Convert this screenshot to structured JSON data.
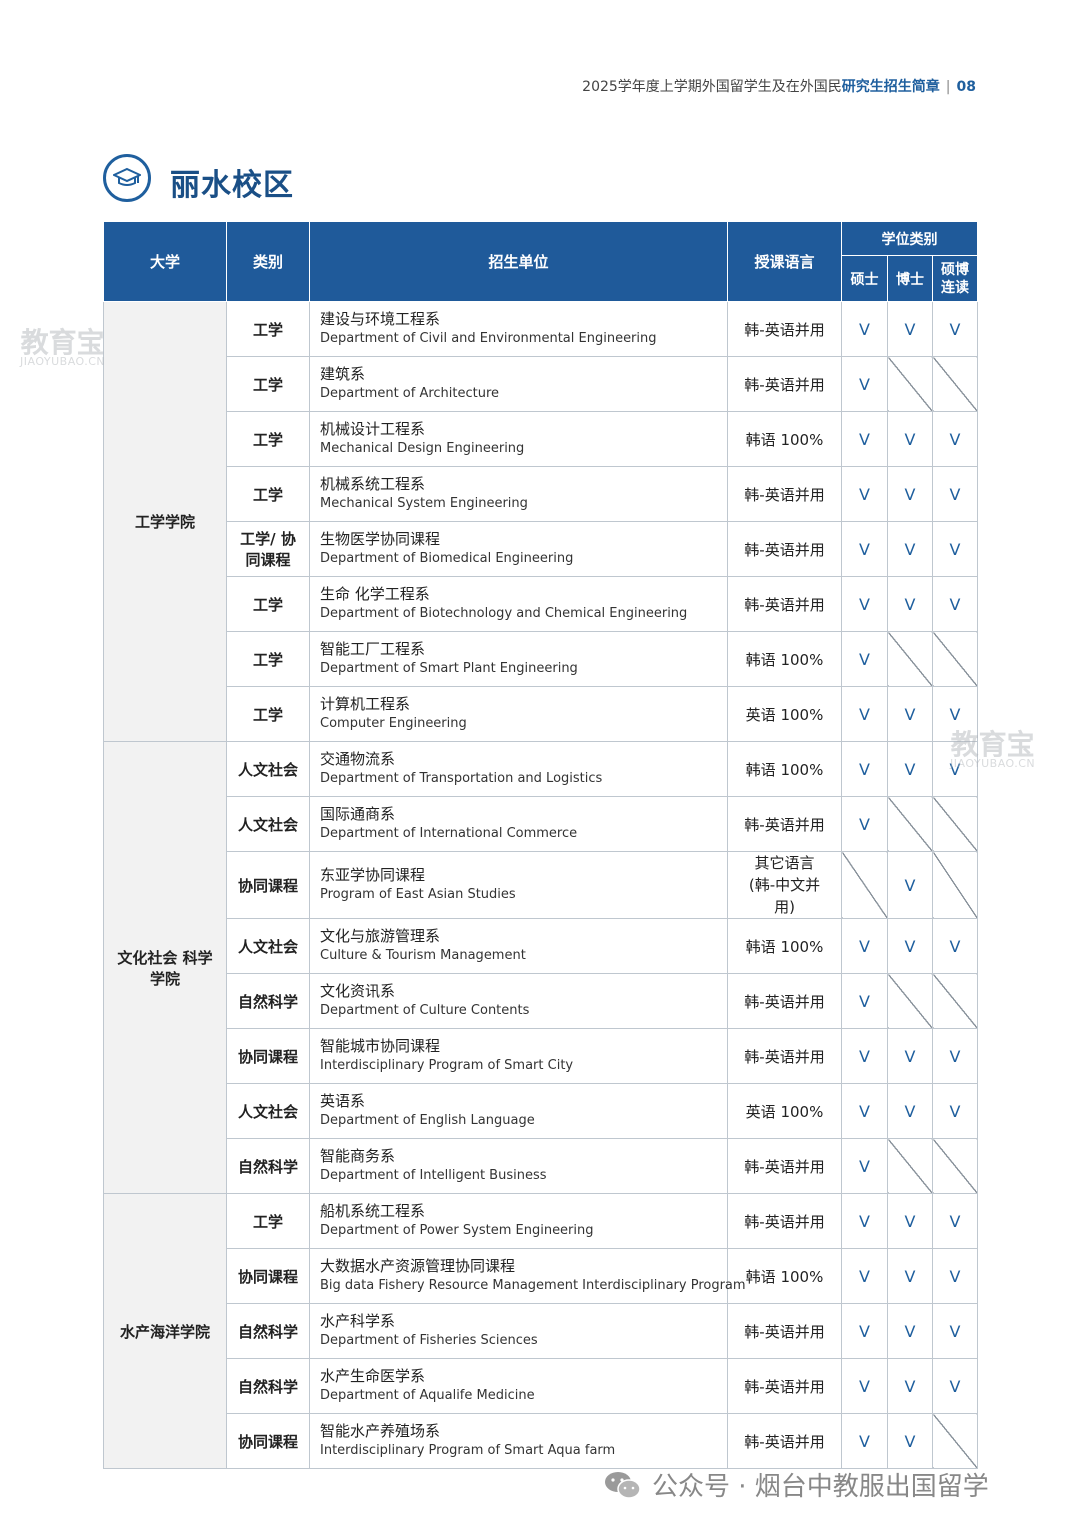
{
  "header": {
    "prefix": "2025学年度上学期外国留学生及在外国民",
    "bold": "研究生招生简章",
    "separator": "|",
    "page": "08"
  },
  "section_title": "丽水校区",
  "table": {
    "headers": {
      "university": "大学",
      "category": "类别",
      "unit": "招生单位",
      "language": "授课语言",
      "degree_group": "学位类别",
      "master": "硕士",
      "doctor": "博士",
      "combined": "硕博连读"
    },
    "groups": [
      {
        "university": "工学学院",
        "rows": [
          {
            "cat": "工学",
            "ko": "建设与环境工程系",
            "en": "Department of Civil and Environmental Engineering",
            "lang": "韩-英语并用",
            "m": "V",
            "d": "V",
            "c": "V"
          },
          {
            "cat": "工学",
            "ko": "建筑系",
            "en": "Department of Architecture",
            "lang": "韩-英语并用",
            "m": "V",
            "d": "",
            "c": ""
          },
          {
            "cat": "工学",
            "ko": "机械设计工程系",
            "en": "Mechanical Design Engineering",
            "lang": "韩语 100%",
            "m": "V",
            "d": "V",
            "c": "V"
          },
          {
            "cat": "工学",
            "ko": "机械系统工程系",
            "en": "Mechanical System Engineering",
            "lang": "韩-英语并用",
            "m": "V",
            "d": "V",
            "c": "V"
          },
          {
            "cat": "工学/ 协同课程",
            "ko": "生物医学协同课程",
            "en": "Department of Biomedical Engineering",
            "lang": "韩-英语并用",
            "m": "V",
            "d": "V",
            "c": "V"
          },
          {
            "cat": "工学",
            "ko": "生命 化学工程系",
            "en": "Department of Biotechnology and Chemical Engineering",
            "lang": "韩-英语并用",
            "m": "V",
            "d": "V",
            "c": "V"
          },
          {
            "cat": "工学",
            "ko": "智能工厂工程系",
            "en": "Department of Smart Plant Engineering",
            "lang": "韩语 100%",
            "m": "V",
            "d": "",
            "c": ""
          },
          {
            "cat": "工学",
            "ko": "计算机工程系",
            "en": "Computer Engineering",
            "lang": "英语 100%",
            "m": "V",
            "d": "V",
            "c": "V"
          }
        ]
      },
      {
        "university": "文化社会 科学学院",
        "rows": [
          {
            "cat": "人文社会",
            "ko": "交通物流系",
            "en": "Department of Transportation and Logistics",
            "lang": "韩语 100%",
            "m": "V",
            "d": "V",
            "c": "V"
          },
          {
            "cat": "人文社会",
            "ko": "国际通商系",
            "en": "Department of International Commerce",
            "lang": "韩-英语并用",
            "m": "V",
            "d": "",
            "c": ""
          },
          {
            "cat": "协同课程",
            "ko": "东亚学协同课程",
            "en": "Program of East Asian Studies",
            "lang": "其它语言 (韩-中文并用)",
            "m": "",
            "d": "V",
            "c": ""
          },
          {
            "cat": "人文社会",
            "ko": "文化与旅游管理系",
            "en": "Culture & Tourism Management",
            "lang": "韩语 100%",
            "m": "V",
            "d": "V",
            "c": "V"
          },
          {
            "cat": "自然科学",
            "ko": "文化资讯系",
            "en": "Department of Culture Contents",
            "lang": "韩-英语并用",
            "m": "V",
            "d": "",
            "c": ""
          },
          {
            "cat": "协同课程",
            "ko": "智能城市协同课程",
            "en": "Interdisciplinary Program of Smart City",
            "lang": "韩-英语并用",
            "m": "V",
            "d": "V",
            "c": "V"
          },
          {
            "cat": "人文社会",
            "ko": "英语系",
            "en": "Department of English Language",
            "lang": "英语 100%",
            "m": "V",
            "d": "V",
            "c": "V"
          },
          {
            "cat": "自然科学",
            "ko": "智能商务系",
            "en": "Department of Intelligent Business",
            "lang": "韩-英语并用",
            "m": "V",
            "d": "",
            "c": ""
          }
        ]
      },
      {
        "university": "水产海洋学院",
        "rows": [
          {
            "cat": "工学",
            "ko": "船机系统工程系",
            "en": "Department of Power System Engineering",
            "lang": "韩-英语并用",
            "m": "V",
            "d": "V",
            "c": "V"
          },
          {
            "cat": "协同课程",
            "ko": "大数据水产资源管理协同课程",
            "en": "Big data Fishery Resource Management Interdisciplinary Program",
            "lang": "韩语 100%",
            "m": "V",
            "d": "V",
            "c": "V"
          },
          {
            "cat": "自然科学",
            "ko": "水产科学系",
            "en": "Department of Fisheries Sciences",
            "lang": "韩-英语并用",
            "m": "V",
            "d": "V",
            "c": "V"
          },
          {
            "cat": "自然科学",
            "ko": "水产生命医学系",
            "en": "Department of Aqualife Medicine",
            "lang": "韩-英语并用",
            "m": "V",
            "d": "V",
            "c": "V"
          },
          {
            "cat": "协同课程",
            "ko": "智能水产养殖场系",
            "en": "Interdisciplinary Program of Smart Aqua farm",
            "lang": "韩-英语并用",
            "m": "V",
            "d": "V",
            "c": ""
          }
        ]
      }
    ]
  },
  "watermark": {
    "cn": "教育宝",
    "en": "JIAOYUBAO.CN"
  },
  "footer": {
    "text": "公众号 · 烟台中教服出国留学"
  },
  "icons": {
    "title_icon": "graduation-cap-icon",
    "footer_icon": "wechat-icon"
  },
  "colors": {
    "accent": "#1f5a9a",
    "title": "#1a4f86",
    "check": "#1f5f9e"
  }
}
